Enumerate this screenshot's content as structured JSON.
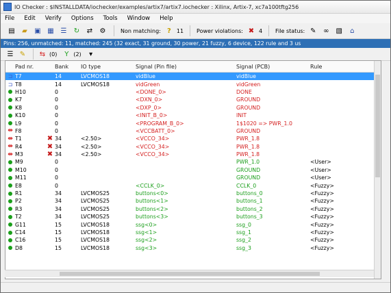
{
  "window": {
    "title": "IO Checker : $INSTALLDATA/iochecker/examples/artix7/artix7.iochecker : Xilinx, Artix-7, xc7a100tftg256"
  },
  "menu": [
    "File",
    "Edit",
    "Verify",
    "Options",
    "Tools",
    "Window",
    "Help"
  ],
  "toolbar": {
    "non_matching_label": "Non matching:",
    "non_matching_count": "11",
    "power_label": "Power violations:",
    "power_count": "4",
    "file_status_label": "File status:"
  },
  "summary": "Pins: 256, unmatched: 11, matched: 245 (32 exact, 31 ground, 30 power, 21 fuzzy, 6 device, 122 rule and 3 us",
  "filterbar": {
    "diff_count": "(0)",
    "rule_count": "(2)"
  },
  "columns": {
    "pad": "Pad nr.",
    "bank": "Bank",
    "io": "IO type",
    "signal": "Signal (Pin file)",
    "pcb": "Signal (PCB)",
    "rule": "Rule"
  },
  "rows": [
    {
      "pad": "T7",
      "bank": "14",
      "io": "LVCMOS18",
      "signal": "vidBlue",
      "pcb": "vidBlue",
      "rule": ""
    },
    {
      "pad": "T8",
      "bank": "14",
      "io": "LVCMOS18",
      "signal": "vidGreen",
      "pcb": "vidGreen",
      "rule": ""
    },
    {
      "pad": "H10",
      "bank": "0",
      "io": "",
      "signal": "<DONE_0>",
      "pcb": "DONE",
      "rule": ""
    },
    {
      "pad": "K7",
      "bank": "0",
      "io": "",
      "signal": "<DXN_0>",
      "pcb": "GROUND",
      "rule": ""
    },
    {
      "pad": "K8",
      "bank": "0",
      "io": "",
      "signal": "<DXP_0>",
      "pcb": "GROUND",
      "rule": ""
    },
    {
      "pad": "K10",
      "bank": "0",
      "io": "",
      "signal": "<INIT_B_0>",
      "pcb": "INIT",
      "rule": ""
    },
    {
      "pad": "L9",
      "bank": "0",
      "io": "",
      "signal": "<PROGRAM_B_0>",
      "pcb": "1$1020 => PWR_1.0",
      "rule": ""
    },
    {
      "pad": "F8",
      "bank": "0",
      "io": "",
      "signal": "<VCCBATT_0>",
      "pcb": "GROUND",
      "rule": ""
    },
    {
      "pad": "T1",
      "bank": "34",
      "io": "<2.50>",
      "signal": "<VCCO_34>",
      "pcb": "PWR_1.8",
      "rule": ""
    },
    {
      "pad": "R4",
      "bank": "34",
      "io": "<2.50>",
      "signal": "<VCCO_34>",
      "pcb": "PWR_1.8",
      "rule": ""
    },
    {
      "pad": "M3",
      "bank": "34",
      "io": "<2.50>",
      "signal": "<VCCO_34>",
      "pcb": "PWR_1.8",
      "rule": ""
    },
    {
      "pad": "M9",
      "bank": "0",
      "io": "",
      "signal": "",
      "pcb": "PWR_1.0",
      "rule": "<User>"
    },
    {
      "pad": "M10",
      "bank": "0",
      "io": "",
      "signal": "",
      "pcb": "GROUND",
      "rule": "<User>"
    },
    {
      "pad": "M11",
      "bank": "0",
      "io": "",
      "signal": "",
      "pcb": "GROUND",
      "rule": "<User>"
    },
    {
      "pad": "E8",
      "bank": "0",
      "io": "",
      "signal": "<CCLK_0>",
      "pcb": "CCLK_0",
      "rule": "<Fuzzy>"
    },
    {
      "pad": "R1",
      "bank": "34",
      "io": "LVCMOS25",
      "signal": "buttons<0>",
      "pcb": "buttons_0",
      "rule": "<Fuzzy>"
    },
    {
      "pad": "P2",
      "bank": "34",
      "io": "LVCMOS25",
      "signal": "buttons<1>",
      "pcb": "buttons_1",
      "rule": "<Fuzzy>"
    },
    {
      "pad": "R3",
      "bank": "34",
      "io": "LVCMOS25",
      "signal": "buttons<2>",
      "pcb": "buttons_2",
      "rule": "<Fuzzy>"
    },
    {
      "pad": "T2",
      "bank": "34",
      "io": "LVCMOS25",
      "signal": "buttons<3>",
      "pcb": "buttons_3",
      "rule": "<Fuzzy>"
    },
    {
      "pad": "G11",
      "bank": "15",
      "io": "LVCMOS18",
      "signal": "ssg<0>",
      "pcb": "ssg_0",
      "rule": "<Fuzzy>"
    },
    {
      "pad": "C14",
      "bank": "15",
      "io": "LVCMOS18",
      "signal": "ssg<1>",
      "pcb": "ssg_1",
      "rule": "<Fuzzy>"
    },
    {
      "pad": "C16",
      "bank": "15",
      "io": "LVCMOS18",
      "signal": "ssg<2>",
      "pcb": "ssg_2",
      "rule": "<Fuzzy>"
    },
    {
      "pad": "D8",
      "bank": "15",
      "io": "LVCMOS18",
      "signal": "ssg<3>",
      "pcb": "ssg_3",
      "rule": "<Fuzzy>"
    }
  ]
}
